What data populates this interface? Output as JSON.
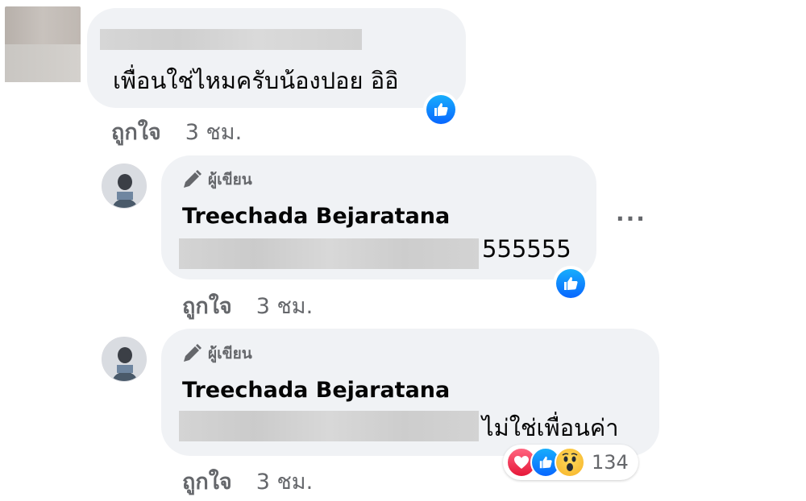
{
  "comment": {
    "text": "เพื่อนใช่ไหมครับน้องปอย อิอิ",
    "like_label": "ถูกใจ",
    "time": "3 ชม."
  },
  "replies": [
    {
      "badge": "ผู้เขียน",
      "author": "Treechada Bejaratana",
      "text_visible": "555555",
      "like_label": "ถูกใจ",
      "time": "3 ชม.",
      "more": "···"
    },
    {
      "badge": "ผู้เขียน",
      "author": "Treechada Bejaratana",
      "text_visible": "ไม่ใช่เพื่อนค่า",
      "like_label": "ถูกใจ",
      "time": "3 ชม.",
      "reaction_count": "134"
    }
  ],
  "icons": {
    "like": "like-icon",
    "love": "love-icon",
    "wow": "wow-icon",
    "author": "pencil-icon"
  },
  "colors": {
    "bubble": "#f0f2f5",
    "like_blue": "#0866ff",
    "love_red": "#e61739",
    "meta_gray": "#65676b"
  }
}
